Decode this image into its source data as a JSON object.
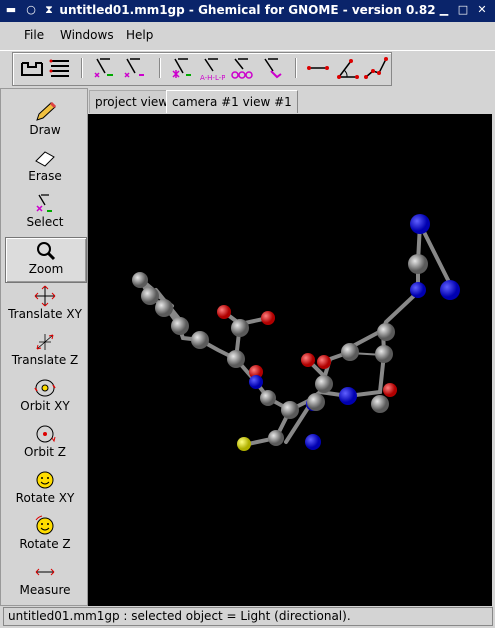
{
  "window": {
    "title": "untitled01.mm1gp - Ghemical for GNOME - version 0.82"
  },
  "menubar": {
    "items": [
      {
        "label": "File"
      },
      {
        "label": "Windows"
      },
      {
        "label": "Help"
      }
    ]
  },
  "toolbar": {
    "icons": [
      "new-molecule-icon",
      "list-icon",
      "select-atoms-icon",
      "select-residues-icon",
      "select-chains-icon",
      "select-ahp-icon",
      "select-rings-icon",
      "select-molecules-icon",
      "measure-distance-icon",
      "measure-angle-icon",
      "measure-torsion-icon"
    ]
  },
  "tools": [
    {
      "label": "Draw"
    },
    {
      "label": "Erase"
    },
    {
      "label": "Select"
    },
    {
      "label": "Zoom"
    },
    {
      "label": "Translate XY"
    },
    {
      "label": "Translate Z"
    },
    {
      "label": "Orbit XY"
    },
    {
      "label": "Orbit Z"
    },
    {
      "label": "Rotate XY"
    },
    {
      "label": "Rotate Z"
    },
    {
      "label": "Measure"
    }
  ],
  "tabs": [
    {
      "label": "project view"
    },
    {
      "label": "camera #1  view #1"
    }
  ],
  "status": {
    "text": "untitled01.mm1gp : selected object = Light (directional)."
  },
  "colors": {
    "carbon": "#9a9a9a",
    "oxygen": "#e00000",
    "nitrogen": "#1010e0",
    "sulfur": "#e8e800",
    "background": "#000000"
  }
}
